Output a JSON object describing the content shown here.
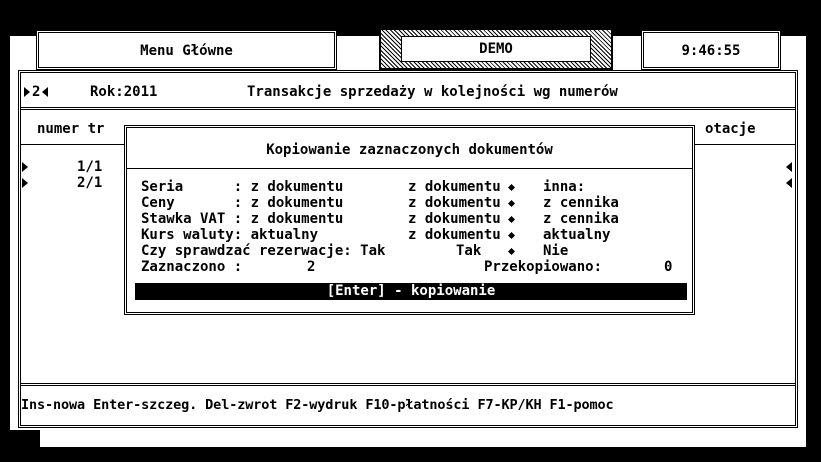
{
  "top_bar": {
    "menu_title": "Menu Główne",
    "company": "DEMO",
    "clock": "9:46:55"
  },
  "main": {
    "nav_marker": "2",
    "year": "Rok:2011",
    "title": "Transakcje sprzedaży w kolejności wg numerów",
    "col_left": "numer tr",
    "col_right": "otacje",
    "rows": [
      "1/1",
      "2/1"
    ]
  },
  "dialog": {
    "title": "Kopiowanie zaznaczonych dokumentów",
    "rows": [
      {
        "label": "Seria      : z dokumentu",
        "opt2": "z dokumentu",
        "opt3": "inna:"
      },
      {
        "label": "Ceny       : z dokumentu",
        "opt2": "z dokumentu",
        "opt3": "z cennika"
      },
      {
        "label": "Stawka VAT : z dokumentu",
        "opt2": "z dokumentu",
        "opt3": "z cennika"
      },
      {
        "label": "Kurs waluty: aktualny   ",
        "opt2": "z dokumentu",
        "opt3": "aktualny"
      },
      {
        "label": "Czy sprawdzać rezerwacje: Tak",
        "opt2": "Tak",
        "opt3": "Nie"
      }
    ],
    "selected_label": "Zaznaczono :",
    "selected_value": "2",
    "copied_label": "Przekopiowano:",
    "copied_value": "0",
    "enter_hint": "[Enter] - kopiowanie"
  },
  "footer": {
    "hotkeys": "Ins-nowa Enter-szczeg. Del-zwrot F2-wydruk F10-płatności F7-KP/KH F1-pomoc"
  }
}
